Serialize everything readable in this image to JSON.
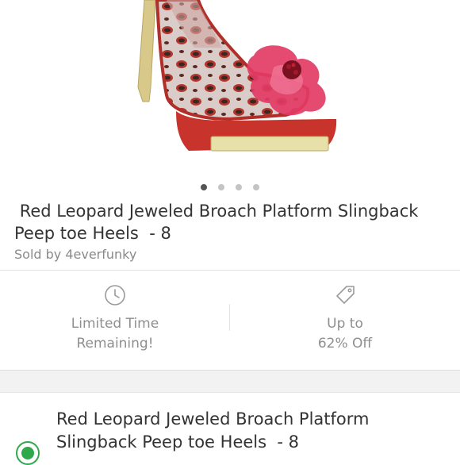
{
  "listing": {
    "title": " Red Leopard Jeweled Broach Platform Slingback Peep toe Heels  - 8",
    "seller": "Sold by 4everfunky",
    "image_icon": "product-photo-red-leopard-heel",
    "carousel": {
      "count": 4,
      "active_index": 0
    }
  },
  "features": {
    "limited": {
      "icon": "clock-icon",
      "line1": "Limited Time",
      "line2": "Remaining!"
    },
    "discount": {
      "icon": "price-tag-icon",
      "line1": "Up to",
      "line2": "62% Off"
    }
  },
  "bundle_item": {
    "title": "Red Leopard Jeweled Broach Platform Slingback Peep toe Heels  - 8",
    "selected": true
  },
  "colors": {
    "accent_green": "#2ea84a",
    "text": "#333333",
    "muted": "#8a8a8a"
  }
}
